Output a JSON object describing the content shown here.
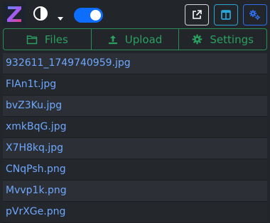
{
  "toolbar": {
    "logo_letter": "Z",
    "dark_mode_enabled": true,
    "icons": {
      "logo": "z-logo-icon",
      "theme": "contrast-icon",
      "dropdown": "caret-down-icon",
      "external": "external-link-icon",
      "panel": "columns-icon",
      "settings": "cogs-icon"
    }
  },
  "tabs": [
    {
      "label": "Files",
      "icon": "folder-icon"
    },
    {
      "label": "Upload",
      "icon": "upload-icon"
    },
    {
      "label": "Settings",
      "icon": "gear-icon"
    }
  ],
  "files": [
    "932611_1749740959.jpg",
    "FIAn1t.jpg",
    "bvZ3Ku.jpg",
    "xmkBqG.jpg",
    "X7H8kq.jpg",
    "CNqPsh.png",
    "Mvvp1k.png",
    "pVrXGe.png"
  ],
  "colors": {
    "background": "#22252a",
    "accent_green": "#2ca05f",
    "link_blue": "#6ea8fe",
    "toggle_blue": "#0d6efd"
  }
}
